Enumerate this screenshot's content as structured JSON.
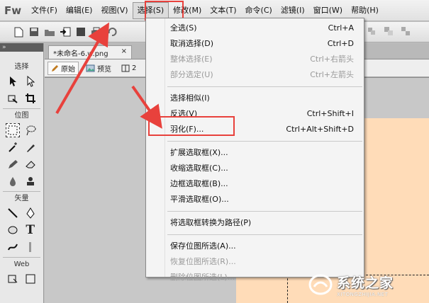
{
  "app": {
    "logo": "Fw"
  },
  "menubar": {
    "items": [
      "文件(F)",
      "编辑(E)",
      "视图(V)",
      "选择(S)",
      "修改(M)",
      "文本(T)",
      "命令(C)",
      "滤镜(I)",
      "窗口(W)",
      "帮助(H)"
    ],
    "active_index": 3
  },
  "document": {
    "tab_title": "*未命名-6.w.png",
    "tab_close": "×",
    "view_original": "原始",
    "view_preview": "预览",
    "view_2up": "2"
  },
  "tools": {
    "top_label": "»",
    "sections": [
      "选择",
      "位图",
      "矢量",
      "Web"
    ]
  },
  "select_menu": {
    "groups": [
      [
        {
          "label": "全选(S)",
          "shortcut": "Ctrl+A",
          "disabled": false
        },
        {
          "label": "取消选择(D)",
          "shortcut": "Ctrl+D",
          "disabled": false
        },
        {
          "label": "整体选择(E)",
          "shortcut": "Ctrl+右箭头",
          "disabled": true
        },
        {
          "label": "部分选定(U)",
          "shortcut": "Ctrl+左箭头",
          "disabled": true
        }
      ],
      [
        {
          "label": "选择相似(I)",
          "shortcut": "",
          "disabled": false
        },
        {
          "label": "反选(V)",
          "shortcut": "Ctrl+Shift+I",
          "disabled": false
        },
        {
          "label": "羽化(F)...",
          "shortcut": "Ctrl+Alt+Shift+D",
          "disabled": false
        }
      ],
      [
        {
          "label": "扩展选取框(X)...",
          "shortcut": "",
          "disabled": false
        },
        {
          "label": "收缩选取框(C)...",
          "shortcut": "",
          "disabled": false
        },
        {
          "label": "边框选取框(B)...",
          "shortcut": "",
          "disabled": false
        },
        {
          "label": "平滑选取框(O)...",
          "shortcut": "",
          "disabled": false
        }
      ],
      [
        {
          "label": "将选取框转换为路径(P)",
          "shortcut": "",
          "disabled": false
        }
      ],
      [
        {
          "label": "保存位图所选(A)...",
          "shortcut": "",
          "disabled": false
        },
        {
          "label": "恢复位图所选(R)...",
          "shortcut": "",
          "disabled": true
        },
        {
          "label": "删除位图所选(L)...",
          "shortcut": "",
          "disabled": true
        }
      ]
    ]
  },
  "watermark": {
    "main": "系统之家",
    "sub": "XITONGZHIJIA.NET"
  },
  "colors": {
    "highlight_red": "#e8413c",
    "canvas_peach": "#ffdcb8"
  }
}
